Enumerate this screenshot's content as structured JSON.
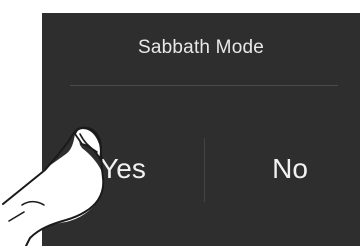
{
  "dialog": {
    "title": "Sabbath Mode",
    "options": {
      "yes_label": "Yes",
      "no_label": "No"
    }
  },
  "colors": {
    "panel_background": "#2e2e2e",
    "text": "#f2f2f2",
    "divider": "#4a4a4a"
  },
  "icons": {
    "pointer": "finger-tap-icon"
  }
}
